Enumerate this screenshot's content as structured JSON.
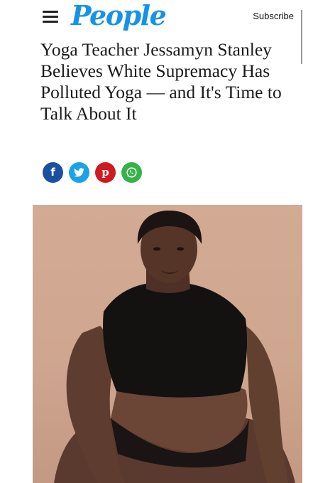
{
  "header": {
    "menu_icon": "hamburger-icon",
    "logo_text": "People",
    "subscribe_label": "Subscribe"
  },
  "article": {
    "headline": "Yoga Teacher Jessamyn Stanley Believes White Supremacy Has Polluted Yoga — and It's Time to Talk About It"
  },
  "share": {
    "facebook": {
      "icon": "facebook-icon",
      "glyph": "f",
      "color": "#1b4fa1"
    },
    "twitter": {
      "icon": "twitter-icon",
      "glyph": "❦",
      "color": "#1aa1e8"
    },
    "pinterest": {
      "icon": "pinterest-icon",
      "glyph": "p",
      "color": "#cf1a20"
    },
    "whatsapp": {
      "icon": "whatsapp-icon",
      "glyph": "☎",
      "color": "#35b34a"
    }
  },
  "colors": {
    "brand": "#1793e6",
    "background": "#ffffff",
    "photo_background": "#d3ab95"
  }
}
